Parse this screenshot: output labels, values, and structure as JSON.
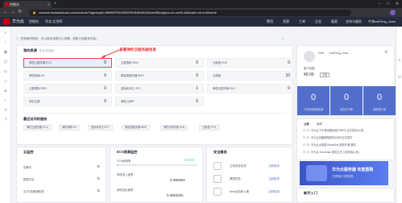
{
  "browser": {
    "tab_title": "控制台",
    "url": "console.huaweicloud.com/console/?agencyId=0fb9f0f79100002591fb8c0015d1ae5f&region=cn-north-4&locale=zh-cn#/home"
  },
  "topnav": {
    "brand": "华为云",
    "items": [
      "控制台",
      "华北-北京四"
    ],
    "right_items": [
      "费用",
      "资源",
      "工单",
      "企业",
      "备案",
      "支持与服务",
      "中文"
    ],
    "user": "huaPeng_closs"
  },
  "notice": {
    "text": "您有新的短信，可以前往消息中心查看。或新订阅更多内容。"
  },
  "resources": {
    "title": "我的资源",
    "subtitle": "华北-北京四",
    "annotation": "查看弹性云服务器信息",
    "cells": [
      {
        "label": "弹性云服务器 ECS",
        "value": "5"
      },
      {
        "label": "云数据库 RDS",
        "value": "0"
      },
      {
        "label": "云硬盘 EVS",
        "value": "0"
      },
      {
        "label": "弹性伸缩 AS",
        "value": "0"
      },
      {
        "label": "裸金属服务器 BMS",
        "value": "0"
      },
      {
        "label": "云硬盘",
        "value": "10"
      },
      {
        "label": "云数据库 RDS",
        "value": "0"
      },
      {
        "label": "虚拟私有云 VPC",
        "value": "1"
      },
      {
        "label": "弹性负载均衡 ELB",
        "value": "0"
      },
      {
        "label": "域名注册",
        "value": "0"
      },
      {
        "label": "弹性公网IP",
        "value": "5"
      }
    ]
  },
  "recent": {
    "title": "最近访问的服务",
    "items": [
      "弹性云服务器 ECS",
      "弹性伸缩 AS",
      "虚拟私有云VPC",
      "裸金属服务器 BMS",
      "弹性负载均衡 ELB",
      "云硬盘 EVS"
    ]
  },
  "alarm": {
    "title": "云监控",
    "rows": [
      {
        "label": "告警中",
        "value": "0"
      },
      {
        "label": "数据不足",
        "value": "0"
      },
      {
        "label": "近7天告警通知数",
        "value": "0"
      }
    ]
  },
  "ecs_monitor": {
    "title": "ECS资源监控",
    "cpu_label": "CPU使用率",
    "cpu_value": "0.83%",
    "cpu_fraction": 0.0083,
    "net_in_label": "网络流入速率",
    "net_in_value": "2.06KB/s",
    "net_out_label": "网络流出速率",
    "net_out_value": "0.00Kbit/s"
  },
  "security": {
    "title": "安全概览",
    "rows": [
      {
        "label": "主机安全检测",
        "link": "立即检测"
      },
      {
        "label": "漏洞扫描",
        "link": "立即检测"
      },
      {
        "label": "Web应用防火墙",
        "link": "立即检测"
      }
    ]
  },
  "account": {
    "id": "0661",
    "name": "huaPeng_closs",
    "balance_label": "账户余额",
    "balance": "¥0.00",
    "recharge": "充值",
    "stats": [
      {
        "num": "0",
        "cap": "7天内待续费资源"
      },
      {
        "num": "0",
        "cap": "待支付订单"
      },
      {
        "num": "0",
        "cap": "待处理工单"
      }
    ]
  },
  "news": {
    "tabs": [
      "公告",
      "新闻"
    ],
    "items": [
      {
        "date": "07-25",
        "text": "华为云 EIS 服务器资源(TBW3) 正式发布(公告)"
      },
      {
        "date": "07-19",
        "text": "华为云容器镜像服务(SWR)正式发布"
      },
      {
        "date": "07-09",
        "text": "华为云大数据 ModelArts 服务开通 通知"
      },
      {
        "date": "07-05",
        "text": "华为云 Dunzhuan 服务正式上线商用(公告)"
      }
    ]
  },
  "promo": {
    "title": "华为云服务器 年度直购",
    "subtitle": "立即购买 享受优惠"
  },
  "guide": {
    "title": "新手入门"
  }
}
